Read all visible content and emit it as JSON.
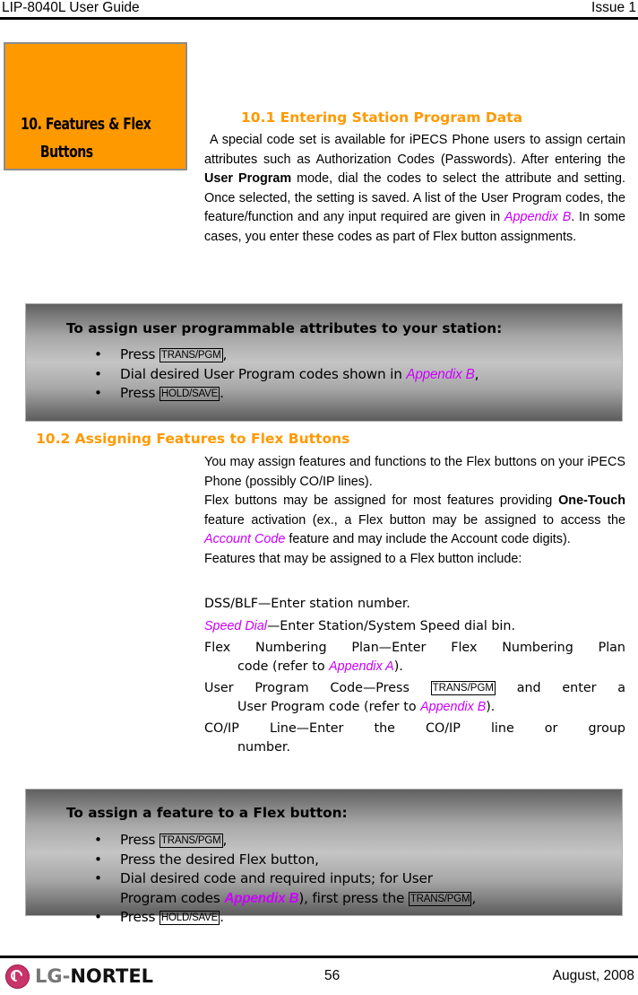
{
  "header": {
    "doc_title": "LIP-8040L User Guide",
    "issue": "Issue 1"
  },
  "chapter": {
    "title_line1": "10. Features & Flex",
    "title_line2": "Buttons",
    "box_color": "#ff9900"
  },
  "section1": {
    "heading": "10.1  Entering Station Program Data",
    "para": {
      "t1": "A special code set is available for iPECS Phone users to assign certain attributes such as Authorization Codes (Passwords).  After entering the ",
      "bold": "User Program",
      "t2": " mode, dial the codes to select the attribute and setting.  Once selected, the setting is saved.  A list of the User Program codes, the feature/function and any input required are given in ",
      "link": "Appendix B",
      "t3": ".  In some cases, you enter these codes as part of Flex button assignments."
    },
    "procedure": {
      "title": "To assign user programmable attributes to your station:",
      "steps": [
        {
          "pre": "Press ",
          "key": "TRANS/PGM",
          "post": ","
        },
        {
          "pre": "Dial desired User Program codes shown in ",
          "link": "Appendix B",
          "post": ","
        },
        {
          "pre": "Press ",
          "key": "HOLD/SAVE",
          "post": "."
        }
      ]
    }
  },
  "section2": {
    "heading": "10.2  Assigning Features to Flex Buttons",
    "para1": "You may assign features and functions to the Flex buttons on your iPECS Phone (possibly CO/IP lines).",
    "para2": {
      "t1": "Flex buttons may be assigned for most features providing ",
      "bold": "One-Touch",
      "t2": " feature activation (ex., a Flex button may be assigned to access the ",
      "link": "Account Code",
      "t3": " feature and may include the Account code digits)."
    },
    "para3": "Features that may be assigned to a Flex button include:",
    "features": [
      {
        "name": "DSS/BLF",
        "desc": "—Enter station number."
      },
      {
        "name": "Speed Dial",
        "desc": "—Enter Station/System Speed dial bin."
      },
      {
        "name": "Flex Numbering Plan",
        "desc": "—Enter Flex Numbering Plan",
        "cont_pre": "code (refer to ",
        "cont_link": "Appendix A",
        "cont_post": ")."
      },
      {
        "name": "User Program Code",
        "desc_pre": "—Press ",
        "key": "TRANS/PGM",
        "desc_post": " and enter a",
        "cont_pre": "User Program code (refer to ",
        "cont_link": "Appendix B",
        "cont_post": ")."
      },
      {
        "name": "CO/IP Line",
        "desc": "—Enter the CO/IP line or group",
        "cont_pre": "number."
      }
    ],
    "procedure": {
      "title": "To assign a feature to a Flex button:",
      "steps": [
        {
          "pre": "Press ",
          "key": "TRANS/PGM",
          "post": ","
        },
        {
          "pre": "Press the desired Flex button,"
        },
        {
          "pre": "Dial desired code and required inputs; for User"
        },
        {
          "pre": "Program codes ",
          "link": "Appendix B",
          "mid": "), first press the ",
          "key": "TRANS/PGM",
          "post": ","
        },
        {
          "pre": "Press ",
          "key": "HOLD/SAVE",
          "post": "."
        }
      ]
    }
  },
  "footer": {
    "logo_lg": "LG",
    "logo_sep": "-",
    "logo_nortel": "NORTEL",
    "page_number": "56",
    "date": "August, 2008"
  },
  "colors": {
    "accent_orange": "#ff9900",
    "link_magenta": "#cc00ff"
  }
}
